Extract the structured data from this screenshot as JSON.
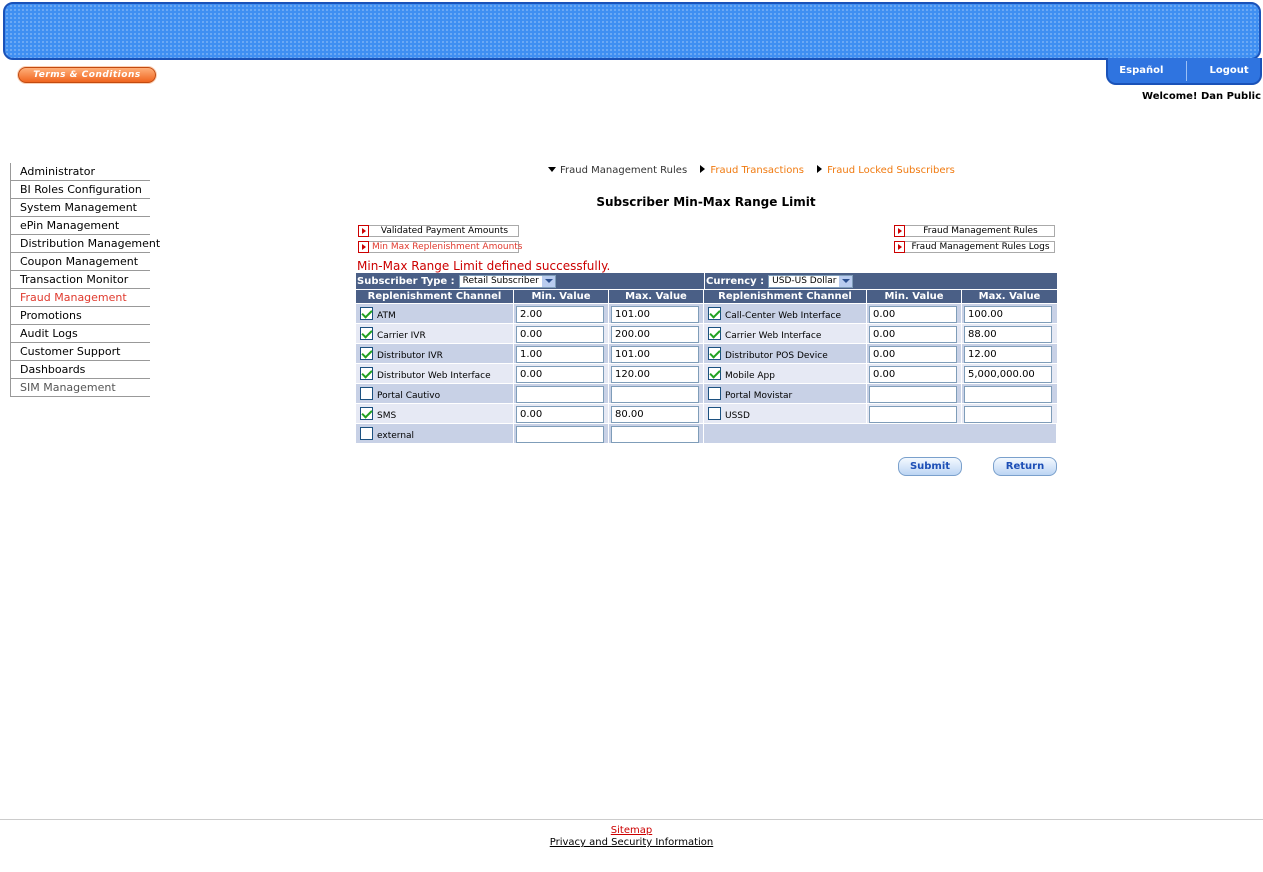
{
  "header": {
    "terms_label": "Terms & Conditions",
    "lang_label": "Español",
    "logout_label": "Logout",
    "welcome_text": "Welcome! Dan Public"
  },
  "sidebar": {
    "items": [
      {
        "label": "Administrator"
      },
      {
        "label": "BI Roles Configuration"
      },
      {
        "label": "System Management"
      },
      {
        "label": "ePin Management"
      },
      {
        "label": "Distribution Management"
      },
      {
        "label": "Coupon Management"
      },
      {
        "label": "Transaction Monitor"
      },
      {
        "label": "Fraud Management",
        "active": true
      },
      {
        "label": "Promotions"
      },
      {
        "label": "Audit Logs"
      },
      {
        "label": "Customer Support"
      },
      {
        "label": "Dashboards"
      },
      {
        "label": "SIM Management"
      }
    ]
  },
  "topnav": {
    "current": "Fraud Management Rules",
    "link1": "Fraud Transactions",
    "link2": "Fraud Locked Subscribers"
  },
  "page": {
    "title": "Subscriber Min-Max Range Limit",
    "success_message": "Min-Max Range Limit defined successfully."
  },
  "sublinks": {
    "validated": "Validated Payment Amounts",
    "minmax": "Min Max Replenishment Amounts",
    "rules": "Fraud Management Rules",
    "rules_logs": "Fraud Management Rules Logs"
  },
  "filters": {
    "subscriber_type_label": "Subscriber Type :",
    "subscriber_type_value": "Retail Subscriber",
    "currency_label": "Currency :",
    "currency_value": "USD-US Dollar"
  },
  "table": {
    "headers": {
      "channel": "Replenishment Channel",
      "min": "Min. Value",
      "max": "Max. Value"
    },
    "rows": [
      {
        "left": {
          "name": "ATM",
          "checked": true,
          "min": "2.00",
          "max": "101.00"
        },
        "right": {
          "name": "Call-Center Web Interface",
          "checked": true,
          "min": "0.00",
          "max": "100.00"
        }
      },
      {
        "left": {
          "name": "Carrier IVR",
          "checked": true,
          "min": "0.00",
          "max": "200.00"
        },
        "right": {
          "name": "Carrier Web Interface",
          "checked": true,
          "min": "0.00",
          "max": "88.00"
        }
      },
      {
        "left": {
          "name": "Distributor IVR",
          "checked": true,
          "min": "1.00",
          "max": "101.00"
        },
        "right": {
          "name": "Distributor POS Device",
          "checked": true,
          "min": "0.00",
          "max": "12.00"
        }
      },
      {
        "left": {
          "name": "Distributor Web Interface",
          "checked": true,
          "min": "0.00",
          "max": "120.00"
        },
        "right": {
          "name": "Mobile App",
          "checked": true,
          "min": "0.00",
          "max": "5,000,000.00"
        }
      },
      {
        "left": {
          "name": "Portal Cautivo",
          "checked": false,
          "min": "",
          "max": ""
        },
        "right": {
          "name": "Portal Movistar",
          "checked": false,
          "min": "",
          "max": ""
        }
      },
      {
        "left": {
          "name": "SMS",
          "checked": true,
          "min": "0.00",
          "max": "80.00"
        },
        "right": {
          "name": "USSD",
          "checked": false,
          "min": "",
          "max": ""
        }
      },
      {
        "left": {
          "name": "external",
          "checked": false,
          "min": "",
          "max": ""
        },
        "right": null
      }
    ]
  },
  "buttons": {
    "submit": "Submit",
    "return": "Return"
  },
  "footer": {
    "sitemap": "Sitemap",
    "privacy": "Privacy and Security Information"
  }
}
